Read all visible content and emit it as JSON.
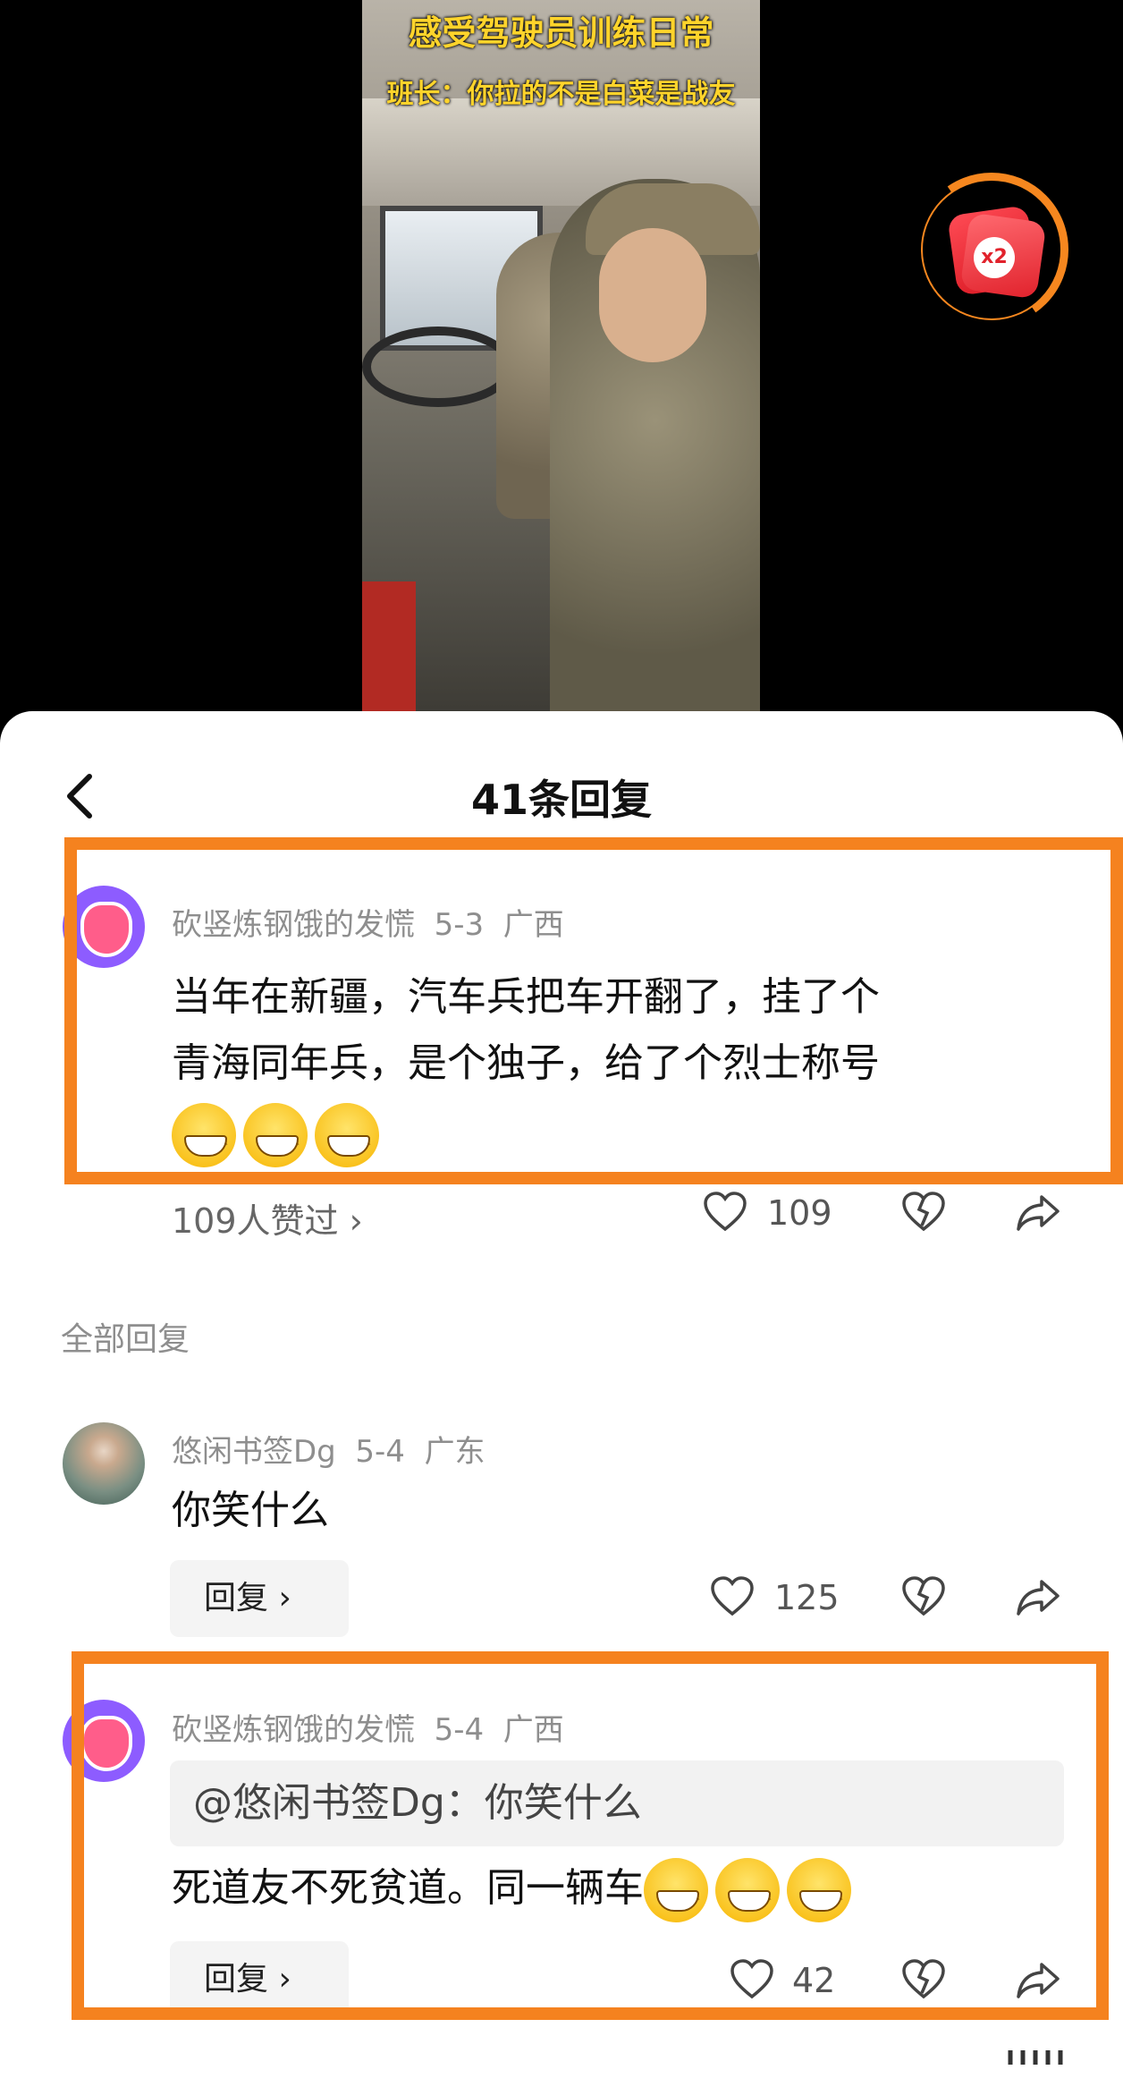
{
  "video": {
    "title_line1": "感受驾驶员训练日常",
    "title_line2": "班长：你拉的不是白菜是战友",
    "reward_badge": "x2"
  },
  "header": {
    "back_icon": "chevron-left-icon",
    "title": "41条回复"
  },
  "main_comment": {
    "author": "砍竖炼钢饿的发慌",
    "date": "5-3",
    "region": "广西",
    "text_line1": "当年在新疆，汽车兵把车开翻了，挂了个",
    "text_line2": "青海同年兵，是个独子，给了个烈士称号",
    "likers_text": "109人赞过",
    "like_count": "109"
  },
  "section_label": "全部回复",
  "replies": [
    {
      "author": "悠闲书签Dg",
      "date": "5-4",
      "region": "广东",
      "text": "你笑什么",
      "reply_label": "回复",
      "like_count": "125"
    },
    {
      "author": "砍竖炼钢饿的发慌",
      "date": "5-4",
      "region": "广西",
      "quote": "@悠闲书签Dg：你笑什么",
      "text": "死道友不死贫道。同一辆车",
      "reply_label": "回复",
      "like_count": "42"
    }
  ],
  "colors": {
    "highlight": "#f5821f",
    "title_yellow": "#ffd42b",
    "badge_red": "#e1222c"
  }
}
